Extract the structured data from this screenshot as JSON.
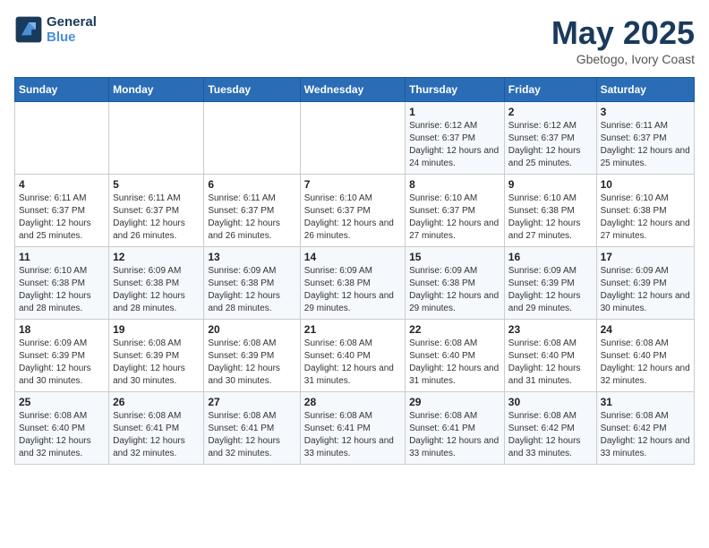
{
  "logo": {
    "line1": "General",
    "line2": "Blue"
  },
  "title": "May 2025",
  "subtitle": "Gbetogo, Ivory Coast",
  "days_of_week": [
    "Sunday",
    "Monday",
    "Tuesday",
    "Wednesday",
    "Thursday",
    "Friday",
    "Saturday"
  ],
  "weeks": [
    [
      {
        "day": "",
        "info": ""
      },
      {
        "day": "",
        "info": ""
      },
      {
        "day": "",
        "info": ""
      },
      {
        "day": "",
        "info": ""
      },
      {
        "day": "1",
        "info": "Sunrise: 6:12 AM\nSunset: 6:37 PM\nDaylight: 12 hours and 24 minutes."
      },
      {
        "day": "2",
        "info": "Sunrise: 6:12 AM\nSunset: 6:37 PM\nDaylight: 12 hours and 25 minutes."
      },
      {
        "day": "3",
        "info": "Sunrise: 6:11 AM\nSunset: 6:37 PM\nDaylight: 12 hours and 25 minutes."
      }
    ],
    [
      {
        "day": "4",
        "info": "Sunrise: 6:11 AM\nSunset: 6:37 PM\nDaylight: 12 hours and 25 minutes."
      },
      {
        "day": "5",
        "info": "Sunrise: 6:11 AM\nSunset: 6:37 PM\nDaylight: 12 hours and 26 minutes."
      },
      {
        "day": "6",
        "info": "Sunrise: 6:11 AM\nSunset: 6:37 PM\nDaylight: 12 hours and 26 minutes."
      },
      {
        "day": "7",
        "info": "Sunrise: 6:10 AM\nSunset: 6:37 PM\nDaylight: 12 hours and 26 minutes."
      },
      {
        "day": "8",
        "info": "Sunrise: 6:10 AM\nSunset: 6:37 PM\nDaylight: 12 hours and 27 minutes."
      },
      {
        "day": "9",
        "info": "Sunrise: 6:10 AM\nSunset: 6:38 PM\nDaylight: 12 hours and 27 minutes."
      },
      {
        "day": "10",
        "info": "Sunrise: 6:10 AM\nSunset: 6:38 PM\nDaylight: 12 hours and 27 minutes."
      }
    ],
    [
      {
        "day": "11",
        "info": "Sunrise: 6:10 AM\nSunset: 6:38 PM\nDaylight: 12 hours and 28 minutes."
      },
      {
        "day": "12",
        "info": "Sunrise: 6:09 AM\nSunset: 6:38 PM\nDaylight: 12 hours and 28 minutes."
      },
      {
        "day": "13",
        "info": "Sunrise: 6:09 AM\nSunset: 6:38 PM\nDaylight: 12 hours and 28 minutes."
      },
      {
        "day": "14",
        "info": "Sunrise: 6:09 AM\nSunset: 6:38 PM\nDaylight: 12 hours and 29 minutes."
      },
      {
        "day": "15",
        "info": "Sunrise: 6:09 AM\nSunset: 6:38 PM\nDaylight: 12 hours and 29 minutes."
      },
      {
        "day": "16",
        "info": "Sunrise: 6:09 AM\nSunset: 6:39 PM\nDaylight: 12 hours and 29 minutes."
      },
      {
        "day": "17",
        "info": "Sunrise: 6:09 AM\nSunset: 6:39 PM\nDaylight: 12 hours and 30 minutes."
      }
    ],
    [
      {
        "day": "18",
        "info": "Sunrise: 6:09 AM\nSunset: 6:39 PM\nDaylight: 12 hours and 30 minutes."
      },
      {
        "day": "19",
        "info": "Sunrise: 6:08 AM\nSunset: 6:39 PM\nDaylight: 12 hours and 30 minutes."
      },
      {
        "day": "20",
        "info": "Sunrise: 6:08 AM\nSunset: 6:39 PM\nDaylight: 12 hours and 30 minutes."
      },
      {
        "day": "21",
        "info": "Sunrise: 6:08 AM\nSunset: 6:40 PM\nDaylight: 12 hours and 31 minutes."
      },
      {
        "day": "22",
        "info": "Sunrise: 6:08 AM\nSunset: 6:40 PM\nDaylight: 12 hours and 31 minutes."
      },
      {
        "day": "23",
        "info": "Sunrise: 6:08 AM\nSunset: 6:40 PM\nDaylight: 12 hours and 31 minutes."
      },
      {
        "day": "24",
        "info": "Sunrise: 6:08 AM\nSunset: 6:40 PM\nDaylight: 12 hours and 32 minutes."
      }
    ],
    [
      {
        "day": "25",
        "info": "Sunrise: 6:08 AM\nSunset: 6:40 PM\nDaylight: 12 hours and 32 minutes."
      },
      {
        "day": "26",
        "info": "Sunrise: 6:08 AM\nSunset: 6:41 PM\nDaylight: 12 hours and 32 minutes."
      },
      {
        "day": "27",
        "info": "Sunrise: 6:08 AM\nSunset: 6:41 PM\nDaylight: 12 hours and 32 minutes."
      },
      {
        "day": "28",
        "info": "Sunrise: 6:08 AM\nSunset: 6:41 PM\nDaylight: 12 hours and 33 minutes."
      },
      {
        "day": "29",
        "info": "Sunrise: 6:08 AM\nSunset: 6:41 PM\nDaylight: 12 hours and 33 minutes."
      },
      {
        "day": "30",
        "info": "Sunrise: 6:08 AM\nSunset: 6:42 PM\nDaylight: 12 hours and 33 minutes."
      },
      {
        "day": "31",
        "info": "Sunrise: 6:08 AM\nSunset: 6:42 PM\nDaylight: 12 hours and 33 minutes."
      }
    ]
  ]
}
